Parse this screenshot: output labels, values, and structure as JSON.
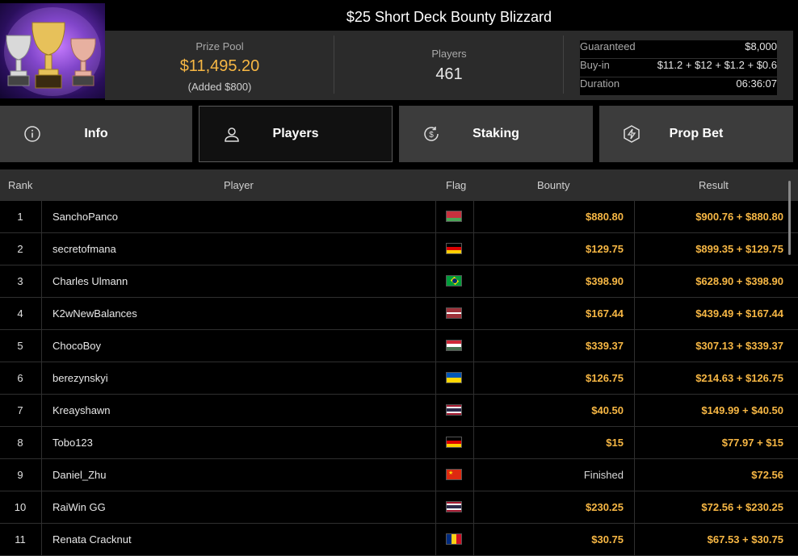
{
  "header": {
    "title": "$25 Short Deck Bounty Blizzard",
    "prize_label": "Prize Pool",
    "prize_amount": "$11,495.20",
    "prize_added": "(Added $800)",
    "players_label": "Players",
    "players_count": "461",
    "guaranteed_label": "Guaranteed",
    "guaranteed_value": "$8,000",
    "buyin_label": "Buy-in",
    "buyin_value": "$11.2 + $12 + $1.2 + $0.6",
    "duration_label": "Duration",
    "duration_value": "06:36:07"
  },
  "tabs": [
    {
      "label": "Info",
      "icon": "info-icon"
    },
    {
      "label": "Players",
      "icon": "user-icon",
      "active": true
    },
    {
      "label": "Staking",
      "icon": "dollar-cycle-icon"
    },
    {
      "label": "Prop Bet",
      "icon": "lightning-shield-icon"
    }
  ],
  "table": {
    "headers": {
      "rank": "Rank",
      "player": "Player",
      "flag": "Flag",
      "bounty": "Bounty",
      "result": "Result"
    },
    "rows": [
      {
        "rank": "1",
        "player": "SanchoPanco",
        "flag": "belarus",
        "bounty": "$880.80",
        "result": "$900.76 + $880.80"
      },
      {
        "rank": "2",
        "player": "secretofmana",
        "flag": "germany",
        "bounty": "$129.75",
        "result": "$899.35 + $129.75"
      },
      {
        "rank": "3",
        "player": "Charles Ulmann",
        "flag": "brazil",
        "bounty": "$398.90",
        "result": "$628.90 + $398.90"
      },
      {
        "rank": "4",
        "player": "K2wNewBalances",
        "flag": "latvia",
        "bounty": "$167.44",
        "result": "$439.49 + $167.44"
      },
      {
        "rank": "5",
        "player": "ChocoBoy",
        "flag": "hungary",
        "bounty": "$339.37",
        "result": "$307.13 + $339.37"
      },
      {
        "rank": "6",
        "player": "berezynskyi",
        "flag": "ukraine",
        "bounty": "$126.75",
        "result": "$214.63 + $126.75"
      },
      {
        "rank": "7",
        "player": "Kreayshawn",
        "flag": "thailand",
        "bounty": "$40.50",
        "result": "$149.99 + $40.50"
      },
      {
        "rank": "8",
        "player": "Tobo123",
        "flag": "germany",
        "bounty": "$15",
        "result": "$77.97 + $15"
      },
      {
        "rank": "9",
        "player": "Daniel_Zhu",
        "flag": "china",
        "bounty": "Finished",
        "result": "$72.56"
      },
      {
        "rank": "10",
        "player": "RaiWin GG",
        "flag": "thailand",
        "bounty": "$230.25",
        "result": "$72.56 + $230.25"
      },
      {
        "rank": "11",
        "player": "Renata Cracknut",
        "flag": "romania",
        "bounty": "$30.75",
        "result": "$67.53 + $30.75"
      }
    ]
  },
  "colors": {
    "accent": "#f7b744",
    "tab_bg": "#3c3c3c",
    "tab_active_bg": "#111111",
    "info_bg": "#2b2b2b"
  }
}
